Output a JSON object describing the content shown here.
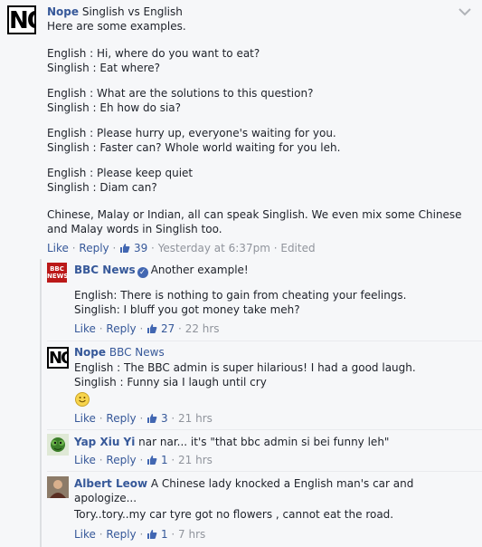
{
  "top_comment": {
    "author": "Nope",
    "lines": [
      "Singlish vs English",
      "Here are some examples.",
      "English : Hi, where do you want to eat?",
      "Singlish : Eat where?",
      "English : What are the solutions to this question?",
      "Singlish : Eh how do sia?",
      "English : Please hurry up, everyone's waiting for you.",
      "Singlish : Faster can? Whole world waiting for you leh.",
      "English : Please keep quiet",
      "Singlish : Diam can?",
      "Chinese, Malay or Indian, all can speak Singlish. We even mix some Chinese",
      "and Malay words in Singlish too."
    ],
    "like": "Like",
    "reply": "Reply",
    "likes": "39",
    "timestamp": "Yesterday at 6:37pm",
    "edited": "Edited"
  },
  "replies": [
    {
      "author": "BBC News",
      "tag": "",
      "lines": [
        "Another example!",
        "English: There is nothing to gain from cheating your feelings.",
        "Singlish: I bluff you got money take meh?"
      ],
      "like": "Like",
      "reply": "Reply",
      "likes": "27",
      "time": "22 hrs"
    },
    {
      "author": "Nope",
      "tag": "BBC News",
      "lines": [
        "English : The BBC admin is super hilarious! I had a good laugh.",
        "Singlish : Funny sia I laugh until cry"
      ],
      "like": "Like",
      "reply": "Reply",
      "likes": "3",
      "time": "21 hrs"
    },
    {
      "author": "Yap Xiu Yi",
      "tag": "",
      "lines": [
        "nar nar... it's \"that bbc admin si bei funny leh\""
      ],
      "like": "Like",
      "reply": "Reply",
      "likes": "1",
      "time": "21 hrs"
    },
    {
      "author": "Albert Leow",
      "tag": "",
      "lines": [
        "A Chinese lady knocked a English man's car and",
        "apologize...",
        "Tory..tory..my car tyre got no flowers , cannot eat the road."
      ],
      "like": "Like",
      "reply": "Reply",
      "likes": "1",
      "time": "7 hrs"
    }
  ],
  "avatars": {
    "nope_logo_text": "NO",
    "bbc_logo_text": "BBC NEWS"
  },
  "colors": {
    "link": "#365899",
    "meta": "#90949c",
    "text": "#1d2129",
    "background": "#f6f7f9",
    "bbc_red": "#bb1919",
    "verified": "#4267b2"
  },
  "icons": [
    "chevron-down-icon",
    "thumbs-up-icon",
    "verified-badge-icon",
    "smile-emoji-icon"
  ]
}
